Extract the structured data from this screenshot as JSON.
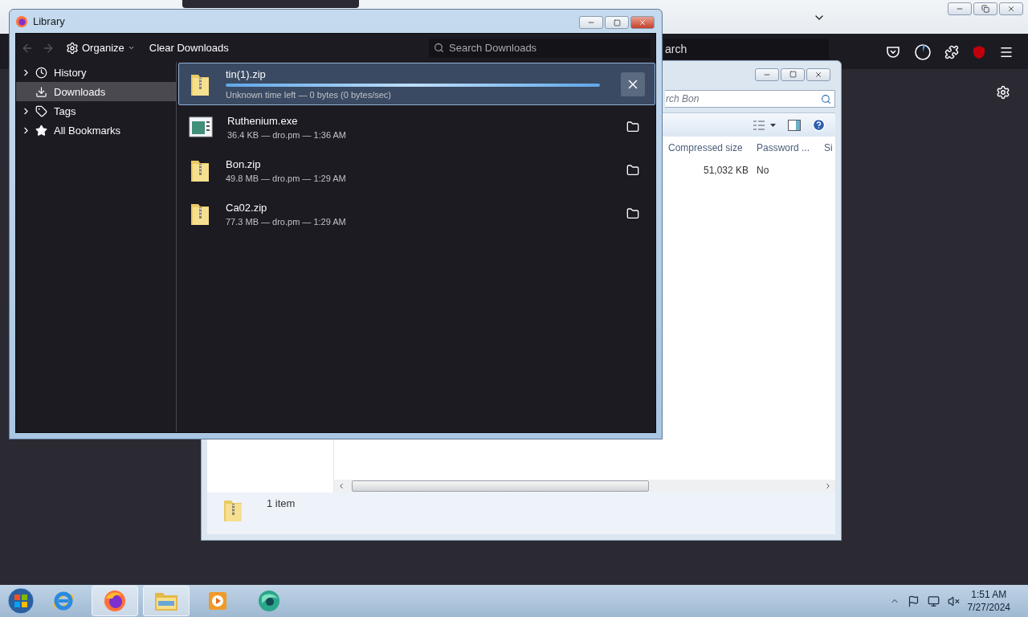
{
  "browser": {
    "search_placeholder": "arch"
  },
  "explorer": {
    "search_placeholder": "rch Bon",
    "columns": [
      "Compressed size",
      "Password ...",
      "Si"
    ],
    "rows": [
      {
        "cells": [
          "51,032 KB",
          "No"
        ]
      }
    ],
    "status": "1 item"
  },
  "library": {
    "title": "Library",
    "organize": "Organize",
    "clear": "Clear Downloads",
    "search_placeholder": "Search Downloads",
    "sidebar": [
      {
        "label": "History",
        "kind": "clock",
        "expandable": true,
        "selected": false
      },
      {
        "label": "Downloads",
        "kind": "download",
        "expandable": false,
        "selected": true
      },
      {
        "label": "Tags",
        "kind": "tag",
        "expandable": true,
        "selected": false
      },
      {
        "label": "All Bookmarks",
        "kind": "star",
        "expandable": true,
        "selected": false
      }
    ],
    "downloads": [
      {
        "name": "tin(1).zip",
        "kind": "zip",
        "in_progress": true,
        "status": "Unknown time left — 0 bytes (0 bytes/sec)",
        "level": 1,
        "selected": true
      },
      {
        "name": "Ruthenium.exe",
        "kind": "exe",
        "in_progress": false,
        "status": "36.4 KB — dro.pm — 1:36 AM",
        "selected": false
      },
      {
        "name": "Bon.zip",
        "kind": "zip",
        "in_progress": false,
        "status": "49.8 MB — dro.pm — 1:29 AM",
        "selected": false
      },
      {
        "name": "Ca02.zip",
        "kind": "zip",
        "in_progress": false,
        "status": "77.3 MB — dro.pm — 1:29 AM",
        "selected": false
      }
    ]
  },
  "taskbar": {
    "apps": [
      {
        "kind": "ie",
        "active": false
      },
      {
        "kind": "firefox",
        "active": true
      },
      {
        "kind": "explorer",
        "active": true
      },
      {
        "kind": "media",
        "active": false
      },
      {
        "kind": "globe",
        "active": false
      }
    ],
    "time": "1:51 AM",
    "date": "7/27/2024"
  }
}
